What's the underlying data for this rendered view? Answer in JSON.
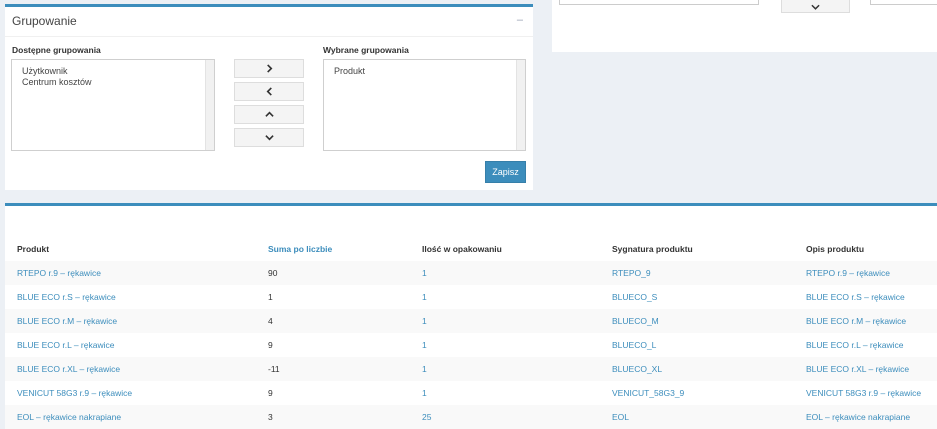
{
  "grouping": {
    "title": "Grupowanie",
    "collapse_icon": "–",
    "available_label": "Dostępne grupowania",
    "available_options": [
      "Użytkownik",
      "Centrum kosztów"
    ],
    "selected_label": "Wybrane grupowania",
    "selected_options": [
      "Produkt"
    ],
    "save_label": "Zapisz"
  },
  "table": {
    "headers": [
      "Produkt",
      "Suma po liczbie",
      "Ilość w opakowaniu",
      "Sygnatura produktu",
      "Opis produktu"
    ],
    "rows": [
      [
        "RTEPO r.9 – rękawice",
        "90",
        "1",
        "RTEPO_9",
        "RTEPO r.9 – rękawice"
      ],
      [
        "BLUE ECO r.S – rękawice",
        "1",
        "1",
        "BLUECO_S",
        "BLUE ECO r.S – rękawice"
      ],
      [
        "BLUE ECO r.M – rękawice",
        "4",
        "1",
        "BLUECO_M",
        "BLUE ECO r.M – rękawice"
      ],
      [
        "BLUE ECO r.L – rękawice",
        "9",
        "1",
        "BLUECO_L",
        "BLUE ECO r.L – rękawice"
      ],
      [
        "BLUE ECO r.XL – rękawice",
        "-11",
        "1",
        "BLUECO_XL",
        "BLUE ECO r.XL – rękawice"
      ],
      [
        "VENICUT 58G3 r.9 – rękawice",
        "9",
        "1",
        "VENICUT_58G3_9",
        "VENICUT 58G3 r.9 – rękawice"
      ],
      [
        "EOL – rękawice nakrapiane",
        "3",
        "25",
        "EOL",
        "EOL – rękawice nakrapiane"
      ]
    ]
  },
  "icons": {
    "move_right": "chevron-right-icon",
    "move_left": "chevron-left-icon",
    "move_up": "chevron-up-icon",
    "move_down": "chevron-down-icon"
  },
  "colors": {
    "accent": "#3c8dbc",
    "background": "#ecf0f5"
  }
}
